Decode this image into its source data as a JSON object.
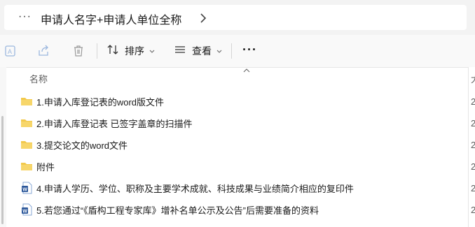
{
  "address_bar": {
    "overflow_label": "···",
    "path": "申请人名字+申请人单位全称",
    "chevron_icon": "chevron-right-icon"
  },
  "command_bar": {
    "icons": [
      "rename-icon",
      "share-icon",
      "delete-icon"
    ],
    "sort_label": "排序",
    "view_label": "查看",
    "more_label": "···"
  },
  "file_list": {
    "column_name": "名称",
    "items": [
      {
        "name": "1.申请入库登记表的word版文件",
        "type": "folder",
        "trail": "2"
      },
      {
        "name": "2.申请入库登记表 已签字盖章的扫描件",
        "type": "folder",
        "trail": "2"
      },
      {
        "name": "3.提交论文的word文件",
        "type": "folder",
        "trail": "2"
      },
      {
        "name": "附件",
        "type": "folder",
        "trail": "2"
      },
      {
        "name": "4.申请人学历、学位、职称及主要学术成就、科技成果与业绩简介相应的复印件",
        "type": "word",
        "trail": "2"
      },
      {
        "name": "5.若您通过“《盾构工程专家库》增补名单公示及公告”后需要准备的资料",
        "type": "word",
        "trail": "2"
      }
    ],
    "right_column_header": "大"
  },
  "colors": {
    "folder": "#f2c94c",
    "word": "#2b579a",
    "accent": "#0067c0"
  }
}
